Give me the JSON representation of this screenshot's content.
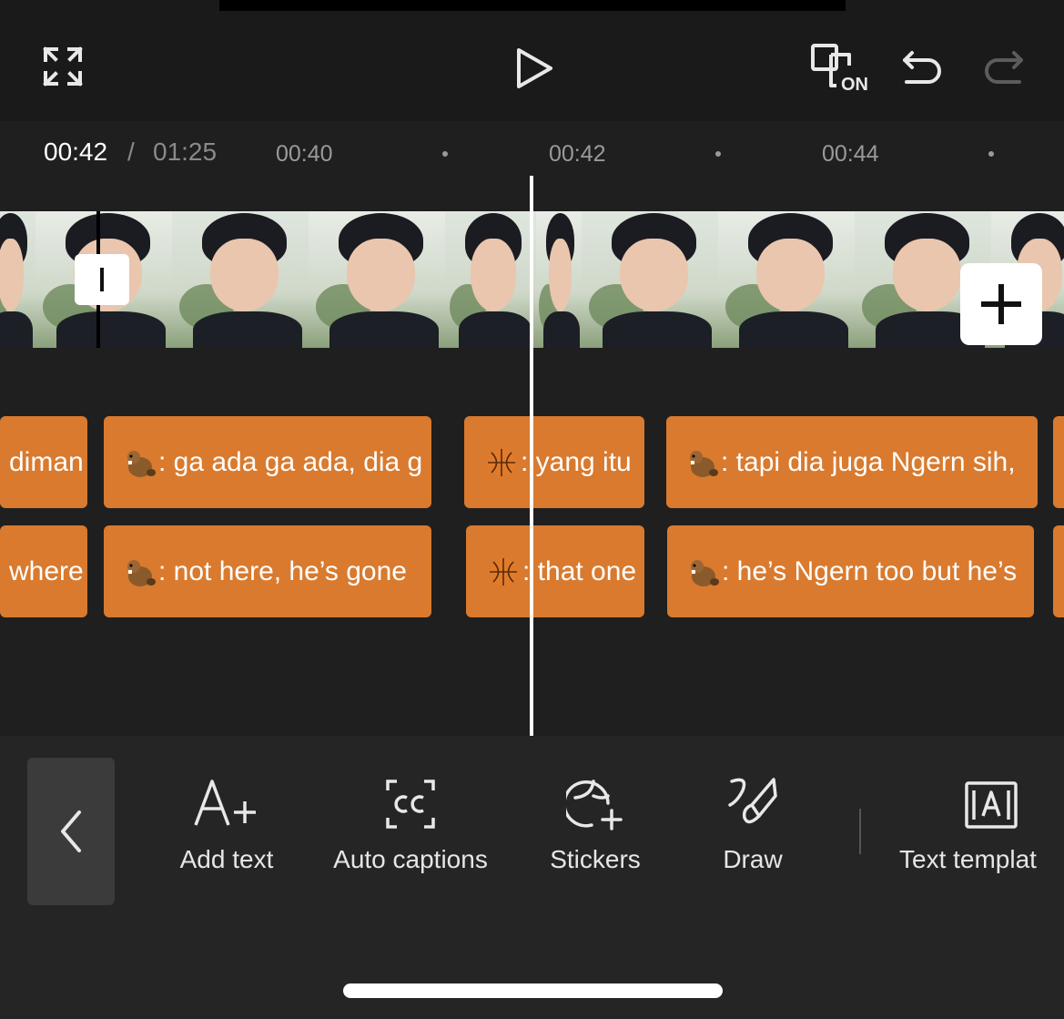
{
  "colors": {
    "background": "#1a1a1a",
    "timeline_bg": "#1f1f1f",
    "text_clip": "#d97a2e",
    "toolbar_bg": "#252525"
  },
  "topbar": {
    "fullscreen_icon": "expand-icon",
    "play_icon": "play-icon",
    "preview_toggle_label": "ON",
    "undo_icon": "undo-icon",
    "redo_icon": "redo-icon"
  },
  "ruler": {
    "current_time": "00:42",
    "separator": "/",
    "total_time": "01:25",
    "ticks": [
      "00:40",
      "00:42",
      "00:44"
    ]
  },
  "text_tracks": {
    "row1": [
      {
        "text": "diman"
      },
      {
        "emoji": "beaver",
        "text": ": ga ada ga ada, dia g"
      },
      {
        "emoji": "basketball",
        "text": ": yang itu"
      },
      {
        "emoji": "beaver",
        "text": ": tapi dia juga Ngern sih,"
      }
    ],
    "row2": [
      {
        "text": "where"
      },
      {
        "emoji": "beaver",
        "text": ": not here, he’s gone"
      },
      {
        "emoji": "basketball",
        "text": ": that one"
      },
      {
        "emoji": "beaver",
        "text": ": he’s Ngern too but he’s"
      }
    ]
  },
  "toolbar": {
    "items": [
      {
        "icon": "add-text-icon",
        "label": "Add text"
      },
      {
        "icon": "auto-captions-icon",
        "label": "Auto captions"
      },
      {
        "icon": "stickers-icon",
        "label": "Stickers"
      },
      {
        "icon": "draw-icon",
        "label": "Draw"
      },
      {
        "icon": "text-template-icon",
        "label": "Text templat"
      }
    ]
  }
}
